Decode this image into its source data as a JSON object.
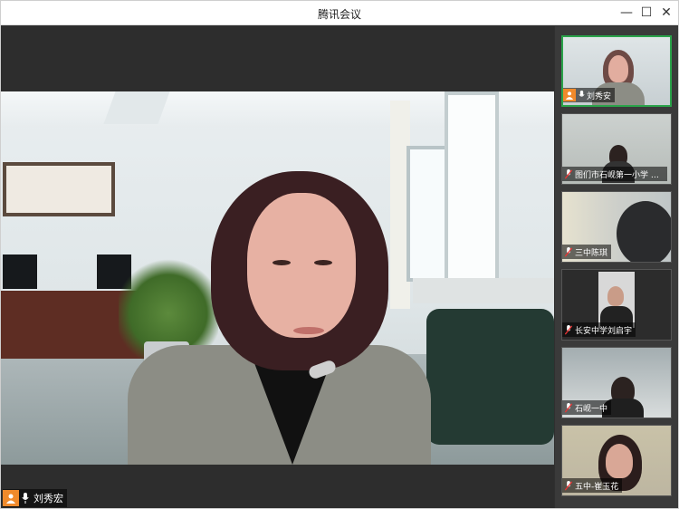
{
  "window": {
    "title": "腾讯会议",
    "controls": {
      "minimize": "—",
      "maximize": "☐",
      "close": "✕"
    }
  },
  "main_video": {
    "speaker_name": "刘秀宏",
    "icons": [
      "user-avatar-icon",
      "microphone-icon"
    ]
  },
  "participants": [
    {
      "name": "刘秀安",
      "active": true
    },
    {
      "name": "图们市石岘第一小学 王…",
      "active": false
    },
    {
      "name": "三中陈琪",
      "active": false
    },
    {
      "name": "长安中学刘启宇",
      "active": false
    },
    {
      "name": "石岘一中",
      "active": false
    },
    {
      "name": "五中-崔玉花",
      "active": false
    }
  ],
  "colors": {
    "accent_orange": "#f08a2b",
    "active_border": "#2aa34a",
    "sidebar_bg": "#3a3a3a",
    "main_bg": "#2d2d2d"
  }
}
